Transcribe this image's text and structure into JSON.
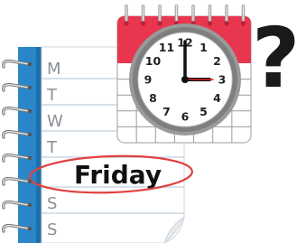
{
  "notepad": {
    "days": [
      "M",
      "T",
      "W",
      "T",
      "Friday",
      "S",
      "S"
    ],
    "highlighted_day": "Friday",
    "spiral_rings": 8,
    "colors": {
      "spine": "#2a86c9",
      "paper": "#ffffff",
      "lines": "#c9d7e4",
      "highlight_circle": "#e0413f",
      "day_letters": "#8a8f96"
    }
  },
  "calendar": {
    "rings": 8,
    "colors": {
      "header": "#e8364e",
      "grid": "#9a9a9a",
      "rings": "#a8a8a8"
    }
  },
  "clock": {
    "numbers": [
      "12",
      "1",
      "2",
      "3",
      "4",
      "5",
      "6",
      "7",
      "8",
      "9",
      "10",
      "11"
    ],
    "time_shown": "3:00",
    "colors": {
      "rim": "#8f8f8f",
      "face": "#ffffff",
      "hands": "#111111",
      "second_hand": "#d9262b"
    }
  },
  "question_mark": {
    "symbol": "?",
    "color": "#1a1a1a"
  }
}
